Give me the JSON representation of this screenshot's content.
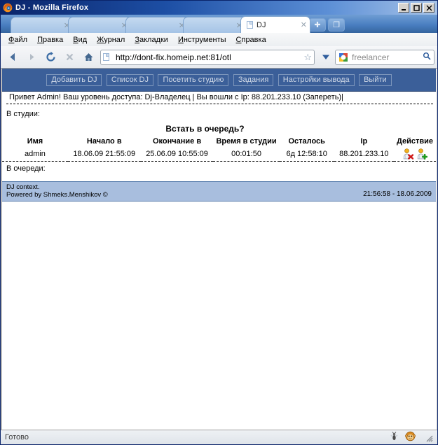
{
  "window": {
    "title": "DJ - Mozilla Firefox",
    "logo_icon": "firefox-logo",
    "minimize_label": "_",
    "maximize_label": "□",
    "close_label": "✕"
  },
  "tabs": {
    "items": [
      {
        "label": "",
        "close_label": "✕",
        "active": false
      },
      {
        "label": "",
        "close_label": "✕",
        "active": false
      },
      {
        "label": "",
        "close_label": "✕",
        "active": false
      },
      {
        "label": "",
        "close_label": "✕",
        "active": false
      },
      {
        "label": "DJ",
        "close_label": "✕",
        "active": true
      }
    ],
    "new_tab_label": "✚",
    "tab_list_label": "❐"
  },
  "menubar": {
    "items": [
      {
        "accesskey": "Ф",
        "rest": "айл"
      },
      {
        "accesskey": "П",
        "rest": "равка"
      },
      {
        "accesskey": "В",
        "rest": "ид"
      },
      {
        "accesskey": "Ж",
        "rest": "урнал"
      },
      {
        "accesskey": "З",
        "rest": "акладки"
      },
      {
        "accesskey": "И",
        "rest": "нструменты"
      },
      {
        "accesskey": "С",
        "rest": "правка"
      }
    ]
  },
  "toolbar": {
    "back_icon": "←",
    "forward_icon": "→",
    "reload_icon": "⟳",
    "stop_icon": "✕",
    "home_icon": "⌂",
    "url_value": "http://dont-fix.homeip.net:81/otl",
    "bookmark_star_icon": "☆",
    "dropdown_icon": "▼",
    "search_engine_icon": "google-icon",
    "search_value": "freelancer",
    "search_icon": "🔍"
  },
  "site": {
    "nav_buttons": [
      "Добавить DJ",
      "Список DJ",
      "Посетить студию",
      "Задания",
      "Настройки вывода",
      "Выйти"
    ],
    "greeting": "Привет Admin! Ваш уровень доступа: Dj-Владелец | Вы вошли с Ip: 88.201.233.10 (Запереть)|",
    "in_studio_label": "В студии:",
    "queue_prompt": "Встать в очередь?",
    "in_queue_label": "В очереди:",
    "table": {
      "headers": [
        "Имя",
        "Начало в",
        "Окончание в",
        "Время в студии",
        "Осталось",
        "Ip",
        "Действие"
      ],
      "rows": [
        {
          "name": "admin",
          "start": "18.06.09 21:55:09",
          "end": "25.06.09 10:55:09",
          "in_studio": "00:01:50",
          "left": "6д 12:58:10",
          "ip": "88.201.233.10",
          "actions": [
            "user-delete-icon",
            "user-add-icon"
          ]
        }
      ]
    },
    "footer": {
      "line1": "DJ context.",
      "line2": "Powered by Shmeks.Menshikov ©",
      "timestamp": "21:56:58 - 18.06.2009"
    }
  },
  "statusbar": {
    "text": "Готово",
    "icons": [
      "firebug-fly-icon",
      "greasemonkey-icon",
      "resize-grip"
    ]
  },
  "colors": {
    "titlebar_start": "#0a246a",
    "site_nav_bg": "#3b5f99",
    "footer_bg": "#a8bede"
  }
}
